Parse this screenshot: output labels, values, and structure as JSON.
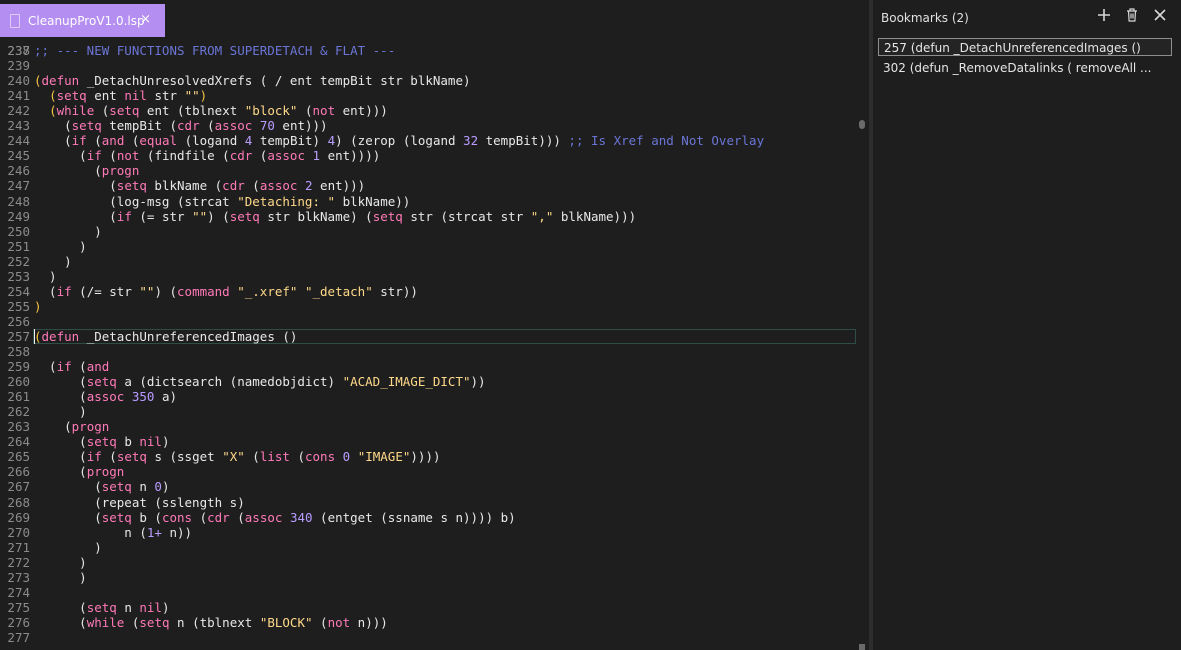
{
  "tab": {
    "filename": "CleanupProV1.0.lsp",
    "close": "×"
  },
  "editor": {
    "top_partial_line_number": "237",
    "lines": [
      {
        "num": "238",
        "tokens": [
          {
            "t": "c",
            "v": ";; --- NEW FUNCTIONS FROM SUPERDETACH & FLAT ---"
          }
        ]
      },
      {
        "num": "239",
        "tokens": []
      },
      {
        "num": "240",
        "tokens": [
          {
            "t": "p",
            "v": "("
          },
          {
            "t": "k",
            "v": "defun"
          },
          {
            "t": "t",
            "v": " _DetachUnresolvedXrefs ( / ent tempBit str blkName)"
          }
        ]
      },
      {
        "num": "241",
        "tokens": [
          {
            "t": "t",
            "v": "  "
          },
          {
            "t": "p",
            "v": "("
          },
          {
            "t": "k",
            "v": "setq"
          },
          {
            "t": "t",
            "v": " ent "
          },
          {
            "t": "k",
            "v": "nil"
          },
          {
            "t": "t",
            "v": " str "
          },
          {
            "t": "s",
            "v": "\"\""
          },
          {
            "t": "p",
            "v": ")"
          }
        ]
      },
      {
        "num": "242",
        "tokens": [
          {
            "t": "t",
            "v": "  "
          },
          {
            "t": "p",
            "v": "("
          },
          {
            "t": "k",
            "v": "while"
          },
          {
            "t": "t",
            "v": " ("
          },
          {
            "t": "k",
            "v": "setq"
          },
          {
            "t": "t",
            "v": " ent (tblnext "
          },
          {
            "t": "s",
            "v": "\"block\""
          },
          {
            "t": "t",
            "v": " ("
          },
          {
            "t": "k",
            "v": "not"
          },
          {
            "t": "t",
            "v": " ent)))"
          }
        ]
      },
      {
        "num": "243",
        "tokens": [
          {
            "t": "t",
            "v": "    ("
          },
          {
            "t": "k",
            "v": "setq"
          },
          {
            "t": "t",
            "v": " tempBit ("
          },
          {
            "t": "k",
            "v": "cdr"
          },
          {
            "t": "t",
            "v": " ("
          },
          {
            "t": "k",
            "v": "assoc"
          },
          {
            "t": "t",
            "v": " "
          },
          {
            "t": "n",
            "v": "70"
          },
          {
            "t": "t",
            "v": " ent)))"
          }
        ]
      },
      {
        "num": "244",
        "tokens": [
          {
            "t": "t",
            "v": "    ("
          },
          {
            "t": "k",
            "v": "if"
          },
          {
            "t": "t",
            "v": " ("
          },
          {
            "t": "k",
            "v": "and"
          },
          {
            "t": "t",
            "v": " ("
          },
          {
            "t": "k",
            "v": "equal"
          },
          {
            "t": "t",
            "v": " (logand "
          },
          {
            "t": "n",
            "v": "4"
          },
          {
            "t": "t",
            "v": " tempBit) "
          },
          {
            "t": "n",
            "v": "4"
          },
          {
            "t": "t",
            "v": ") (zerop (logand "
          },
          {
            "t": "n",
            "v": "32"
          },
          {
            "t": "t",
            "v": " tempBit))) "
          },
          {
            "t": "c",
            "v": ";; Is Xref and Not Overlay"
          }
        ]
      },
      {
        "num": "245",
        "tokens": [
          {
            "t": "t",
            "v": "      ("
          },
          {
            "t": "k",
            "v": "if"
          },
          {
            "t": "t",
            "v": " ("
          },
          {
            "t": "k",
            "v": "not"
          },
          {
            "t": "t",
            "v": " (findfile ("
          },
          {
            "t": "k",
            "v": "cdr"
          },
          {
            "t": "t",
            "v": " ("
          },
          {
            "t": "k",
            "v": "assoc"
          },
          {
            "t": "t",
            "v": " "
          },
          {
            "t": "n",
            "v": "1"
          },
          {
            "t": "t",
            "v": " ent))))"
          }
        ]
      },
      {
        "num": "246",
        "tokens": [
          {
            "t": "t",
            "v": "        ("
          },
          {
            "t": "k",
            "v": "progn"
          }
        ]
      },
      {
        "num": "247",
        "tokens": [
          {
            "t": "t",
            "v": "          ("
          },
          {
            "t": "k",
            "v": "setq"
          },
          {
            "t": "t",
            "v": " blkName ("
          },
          {
            "t": "k",
            "v": "cdr"
          },
          {
            "t": "t",
            "v": " ("
          },
          {
            "t": "k",
            "v": "assoc"
          },
          {
            "t": "t",
            "v": " "
          },
          {
            "t": "n",
            "v": "2"
          },
          {
            "t": "t",
            "v": " ent)))"
          }
        ]
      },
      {
        "num": "248",
        "tokens": [
          {
            "t": "t",
            "v": "          (log-msg (strcat "
          },
          {
            "t": "s",
            "v": "\"Detaching: \""
          },
          {
            "t": "t",
            "v": " blkName))"
          }
        ]
      },
      {
        "num": "249",
        "tokens": [
          {
            "t": "t",
            "v": "          ("
          },
          {
            "t": "k",
            "v": "if"
          },
          {
            "t": "t",
            "v": " (= str "
          },
          {
            "t": "s",
            "v": "\"\""
          },
          {
            "t": "t",
            "v": ") ("
          },
          {
            "t": "k",
            "v": "setq"
          },
          {
            "t": "t",
            "v": " str blkName) ("
          },
          {
            "t": "k",
            "v": "setq"
          },
          {
            "t": "t",
            "v": " str (strcat str "
          },
          {
            "t": "s",
            "v": "\",\""
          },
          {
            "t": "t",
            "v": " blkName)))"
          }
        ]
      },
      {
        "num": "250",
        "tokens": [
          {
            "t": "t",
            "v": "        )"
          }
        ]
      },
      {
        "num": "251",
        "tokens": [
          {
            "t": "t",
            "v": "      )"
          }
        ]
      },
      {
        "num": "252",
        "tokens": [
          {
            "t": "t",
            "v": "    )"
          }
        ]
      },
      {
        "num": "253",
        "tokens": [
          {
            "t": "t",
            "v": "  )"
          }
        ]
      },
      {
        "num": "254",
        "tokens": [
          {
            "t": "t",
            "v": "  ("
          },
          {
            "t": "k",
            "v": "if"
          },
          {
            "t": "t",
            "v": " (/= str "
          },
          {
            "t": "s",
            "v": "\"\""
          },
          {
            "t": "t",
            "v": ") ("
          },
          {
            "t": "k",
            "v": "command"
          },
          {
            "t": "t",
            "v": " "
          },
          {
            "t": "s",
            "v": "\"_.xref\""
          },
          {
            "t": "t",
            "v": " "
          },
          {
            "t": "s",
            "v": "\"_detach\""
          },
          {
            "t": "t",
            "v": " str))"
          }
        ]
      },
      {
        "num": "255",
        "tokens": [
          {
            "t": "p",
            "v": ")"
          }
        ]
      },
      {
        "num": "256",
        "tokens": []
      },
      {
        "num": "257",
        "tokens": [
          {
            "t": "p",
            "v": "("
          },
          {
            "t": "k",
            "v": "defun"
          },
          {
            "t": "t",
            "v": " _DetachUnreferencedImages ()"
          }
        ],
        "current": true
      },
      {
        "num": "258",
        "tokens": []
      },
      {
        "num": "259",
        "tokens": [
          {
            "t": "t",
            "v": "  ("
          },
          {
            "t": "k",
            "v": "if"
          },
          {
            "t": "t",
            "v": " ("
          },
          {
            "t": "k",
            "v": "and"
          }
        ]
      },
      {
        "num": "260",
        "tokens": [
          {
            "t": "t",
            "v": "      ("
          },
          {
            "t": "k",
            "v": "setq"
          },
          {
            "t": "t",
            "v": " a (dictsearch (namedobjdict) "
          },
          {
            "t": "s",
            "v": "\"ACAD_IMAGE_DICT\""
          },
          {
            "t": "t",
            "v": "))"
          }
        ]
      },
      {
        "num": "261",
        "tokens": [
          {
            "t": "t",
            "v": "      ("
          },
          {
            "t": "k",
            "v": "assoc"
          },
          {
            "t": "t",
            "v": " "
          },
          {
            "t": "n",
            "v": "350"
          },
          {
            "t": "t",
            "v": " a)"
          }
        ]
      },
      {
        "num": "262",
        "tokens": [
          {
            "t": "t",
            "v": "      )"
          }
        ]
      },
      {
        "num": "263",
        "tokens": [
          {
            "t": "t",
            "v": "    ("
          },
          {
            "t": "k",
            "v": "progn"
          }
        ]
      },
      {
        "num": "264",
        "tokens": [
          {
            "t": "t",
            "v": "      ("
          },
          {
            "t": "k",
            "v": "setq"
          },
          {
            "t": "t",
            "v": " b "
          },
          {
            "t": "k",
            "v": "nil"
          },
          {
            "t": "t",
            "v": ")"
          }
        ]
      },
      {
        "num": "265",
        "tokens": [
          {
            "t": "t",
            "v": "      ("
          },
          {
            "t": "k",
            "v": "if"
          },
          {
            "t": "t",
            "v": " ("
          },
          {
            "t": "k",
            "v": "setq"
          },
          {
            "t": "t",
            "v": " s (ssget "
          },
          {
            "t": "s",
            "v": "\"X\""
          },
          {
            "t": "t",
            "v": " ("
          },
          {
            "t": "k",
            "v": "list"
          },
          {
            "t": "t",
            "v": " ("
          },
          {
            "t": "k",
            "v": "cons"
          },
          {
            "t": "t",
            "v": " "
          },
          {
            "t": "n",
            "v": "0"
          },
          {
            "t": "t",
            "v": " "
          },
          {
            "t": "s",
            "v": "\"IMAGE\""
          },
          {
            "t": "t",
            "v": "))))"
          }
        ]
      },
      {
        "num": "266",
        "tokens": [
          {
            "t": "t",
            "v": "      ("
          },
          {
            "t": "k",
            "v": "progn"
          }
        ]
      },
      {
        "num": "267",
        "tokens": [
          {
            "t": "t",
            "v": "        ("
          },
          {
            "t": "k",
            "v": "setq"
          },
          {
            "t": "t",
            "v": " n "
          },
          {
            "t": "n",
            "v": "0"
          },
          {
            "t": "t",
            "v": ")"
          }
        ]
      },
      {
        "num": "268",
        "tokens": [
          {
            "t": "t",
            "v": "        (repeat (sslength s)"
          }
        ]
      },
      {
        "num": "269",
        "tokens": [
          {
            "t": "t",
            "v": "        ("
          },
          {
            "t": "k",
            "v": "setq"
          },
          {
            "t": "t",
            "v": " b ("
          },
          {
            "t": "k",
            "v": "cons"
          },
          {
            "t": "t",
            "v": " ("
          },
          {
            "t": "k",
            "v": "cdr"
          },
          {
            "t": "t",
            "v": " ("
          },
          {
            "t": "k",
            "v": "assoc"
          },
          {
            "t": "t",
            "v": " "
          },
          {
            "t": "n",
            "v": "340"
          },
          {
            "t": "t",
            "v": " (entget (ssname s n)))) b)"
          }
        ]
      },
      {
        "num": "270",
        "tokens": [
          {
            "t": "t",
            "v": "            n ("
          },
          {
            "t": "n",
            "v": "1+"
          },
          {
            "t": "t",
            "v": " n))"
          }
        ]
      },
      {
        "num": "271",
        "tokens": [
          {
            "t": "t",
            "v": "        )"
          }
        ]
      },
      {
        "num": "272",
        "tokens": [
          {
            "t": "t",
            "v": "      )"
          }
        ]
      },
      {
        "num": "273",
        "tokens": [
          {
            "t": "t",
            "v": "      )"
          }
        ]
      },
      {
        "num": "274",
        "tokens": []
      },
      {
        "num": "275",
        "tokens": [
          {
            "t": "t",
            "v": "      ("
          },
          {
            "t": "k",
            "v": "setq"
          },
          {
            "t": "t",
            "v": " n "
          },
          {
            "t": "k",
            "v": "nil"
          },
          {
            "t": "t",
            "v": ")"
          }
        ]
      },
      {
        "num": "276",
        "tokens": [
          {
            "t": "t",
            "v": "      ("
          },
          {
            "t": "k",
            "v": "while"
          },
          {
            "t": "t",
            "v": " ("
          },
          {
            "t": "k",
            "v": "setq"
          },
          {
            "t": "t",
            "v": " n (tblnext "
          },
          {
            "t": "s",
            "v": "\"BLOCK\""
          },
          {
            "t": "t",
            "v": " ("
          },
          {
            "t": "k",
            "v": "not"
          },
          {
            "t": "t",
            "v": " n)))"
          }
        ]
      },
      {
        "num": "277",
        "tokens": []
      }
    ]
  },
  "bookmarks": {
    "title": "Bookmarks (2)",
    "items": [
      {
        "line": "257",
        "text": "(defun _DetachUnreferencedImages ()",
        "selected": true
      },
      {
        "line": "302",
        "text": "(defun _RemoveDatalinks ( removeAll ...",
        "selected": false
      }
    ],
    "add_icon": "+",
    "delete_icon": "🗑",
    "close_icon": "×"
  },
  "colors": {
    "background": "#1e1e1e",
    "tab_bg": "#b48ef0",
    "keyword": "#ff7ab8",
    "string": "#ffd98a",
    "number": "#b99cff",
    "comment": "#6b75d6"
  }
}
